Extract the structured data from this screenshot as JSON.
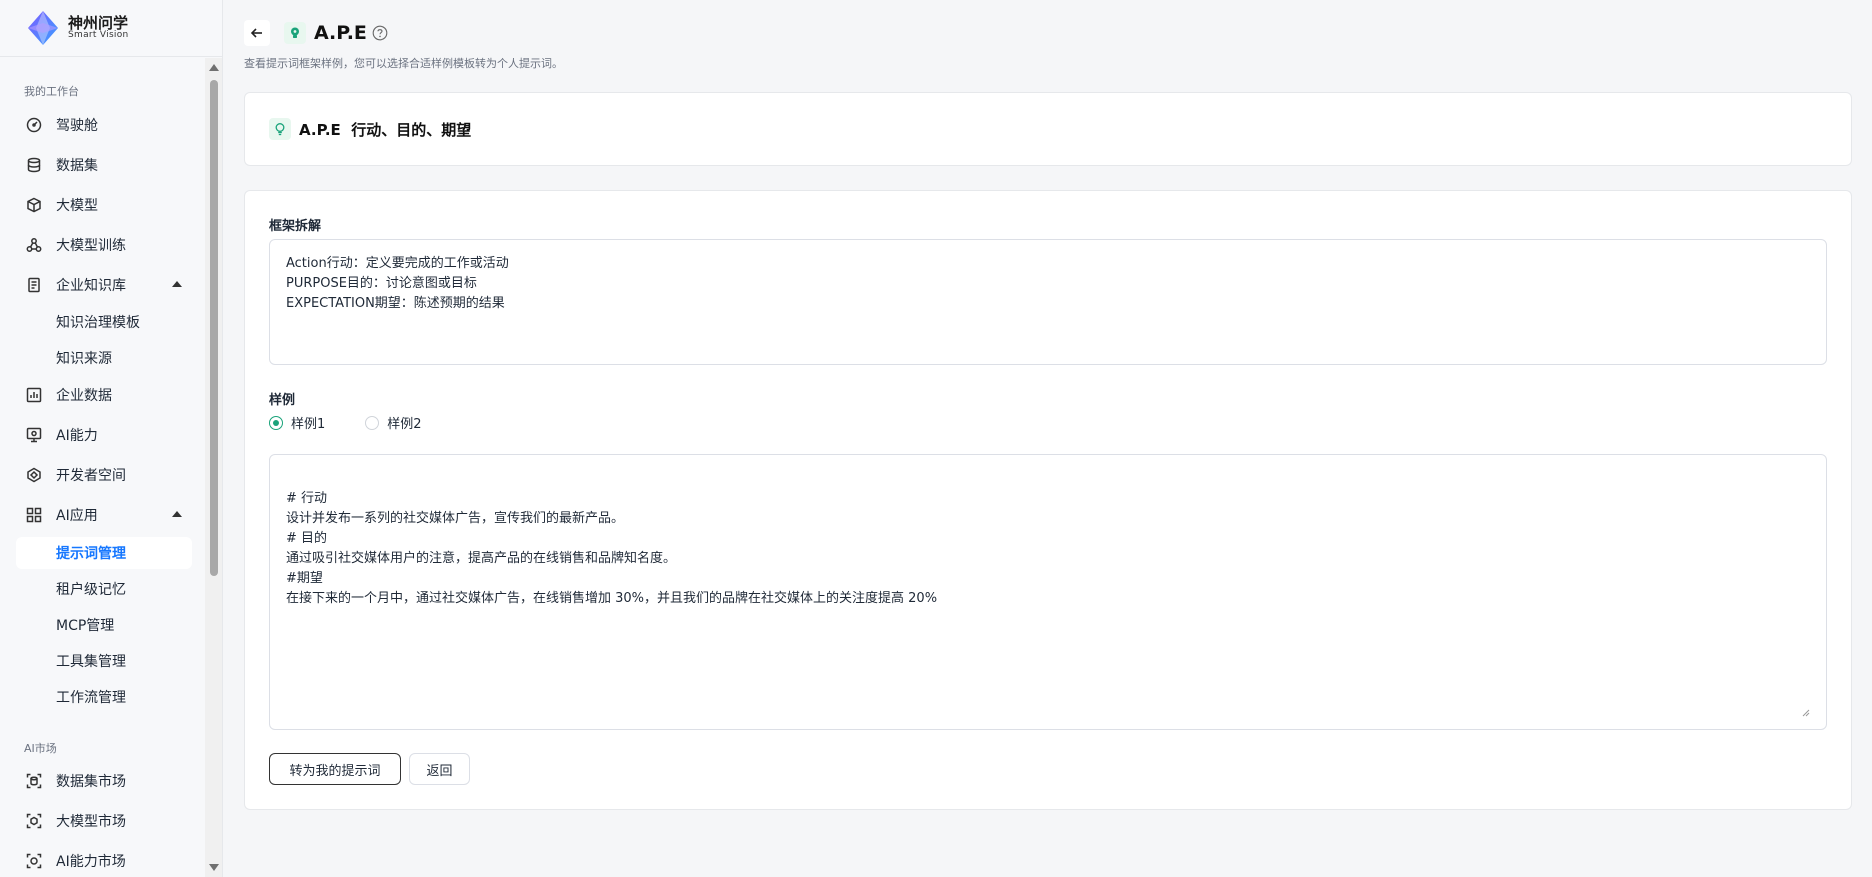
{
  "brand": {
    "name_cn": "神州问学",
    "name_en": "Smart Vision"
  },
  "sidebar": {
    "section_workspace": "我的工作台",
    "items": [
      {
        "label": "驾驶舱",
        "icon": "dashboard-icon"
      },
      {
        "label": "数据集",
        "icon": "database-icon"
      },
      {
        "label": "大模型",
        "icon": "cube-icon"
      },
      {
        "label": "大模型训练",
        "icon": "training-icon"
      },
      {
        "label": "企业知识库",
        "icon": "knowledge-icon",
        "expanded": true
      },
      {
        "label": "企业数据",
        "icon": "chart-icon"
      },
      {
        "label": "AI能力",
        "icon": "ai-capability-icon"
      },
      {
        "label": "开发者空间",
        "icon": "developer-icon"
      },
      {
        "label": "AI应用",
        "icon": "apps-grid-icon",
        "expanded": true
      }
    ],
    "knowledge_sub": [
      "知识治理模板",
      "知识来源"
    ],
    "apps_sub": [
      "提示词管理",
      "租户级记忆",
      "MCP管理",
      "工具集管理",
      "工作流管理"
    ],
    "active_sub": "提示词管理",
    "section_market": "AI市场",
    "market_items": [
      {
        "label": "数据集市场",
        "icon": "dataset-market-icon"
      },
      {
        "label": "大模型市场",
        "icon": "model-market-icon"
      },
      {
        "label": "AI能力市场",
        "icon": "ai-market-icon"
      }
    ]
  },
  "header": {
    "title": "A.P.E",
    "subtitle": "查看提示词框架样例，您可以选择合适样例模板转为个人提示词。"
  },
  "framework_card": {
    "title": "A.P.E  行动、目的、期望"
  },
  "breakdown": {
    "label": "框架拆解",
    "text": "Action行动：定义要完成的工作或活动\nPURPOSE目的：讨论意图或目标\nEXPECTATION期望：陈述预期的结果"
  },
  "examples": {
    "label": "样例",
    "options": [
      "样例1",
      "样例2"
    ],
    "selected": "样例1",
    "content": "# 行动\n设计并发布一系列的社交媒体广告，宣传我们的最新产品。\n# 目的\n通过吸引社交媒体用户的注意，提高产品的在线销售和品牌知名度。\n#期望\n在接下来的一个月中，通过社交媒体广告，在线销售增加 30%，并且我们的品牌在社交媒体上的关注度提高 20%"
  },
  "actions": {
    "convert_label": "转为我的提示词",
    "back_label": "返回"
  },
  "colors": {
    "accent_green": "#1aa37a",
    "active_blue": "#1677ff"
  }
}
